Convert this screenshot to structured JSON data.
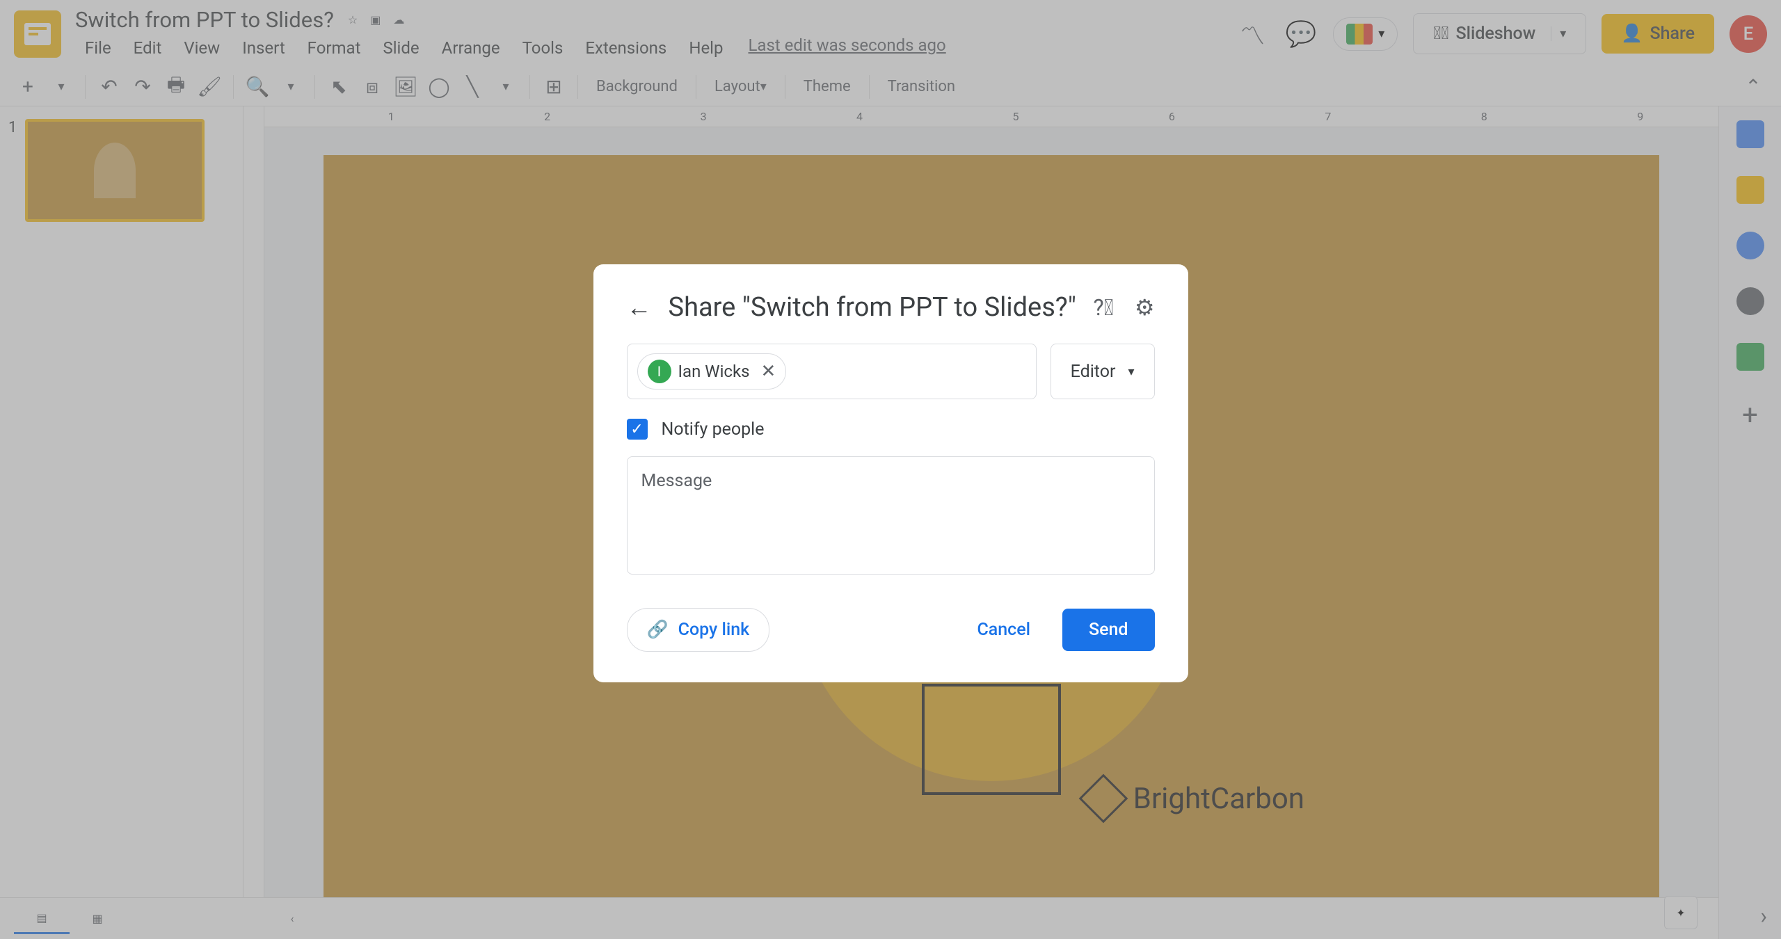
{
  "document": {
    "title": "Switch from PPT to Slides?",
    "last_edit": "Last edit was seconds ago"
  },
  "menus": [
    "File",
    "Edit",
    "View",
    "Insert",
    "Format",
    "Slide",
    "Arrange",
    "Tools",
    "Extensions",
    "Help"
  ],
  "header": {
    "slideshow_label": "Slideshow",
    "share_label": "Share",
    "avatar_initial": "E"
  },
  "toolbar": {
    "background": "Background",
    "layout": "Layout",
    "theme": "Theme",
    "transition": "Transition"
  },
  "ruler_marks": [
    "1",
    "2",
    "3",
    "4",
    "5",
    "6",
    "7",
    "8",
    "9"
  ],
  "film_strip": {
    "slide_number": "1"
  },
  "slide": {
    "brand": "BrightCarbon"
  },
  "dialog": {
    "title": "Share \"Switch from PPT to Slides?\"",
    "person_chip": {
      "initial": "I",
      "name": "Ian Wicks"
    },
    "role": "Editor",
    "notify_label": "Notify people",
    "notify_checked": true,
    "message_placeholder": "Message",
    "copy_link_label": "Copy link",
    "cancel_label": "Cancel",
    "send_label": "Send"
  }
}
